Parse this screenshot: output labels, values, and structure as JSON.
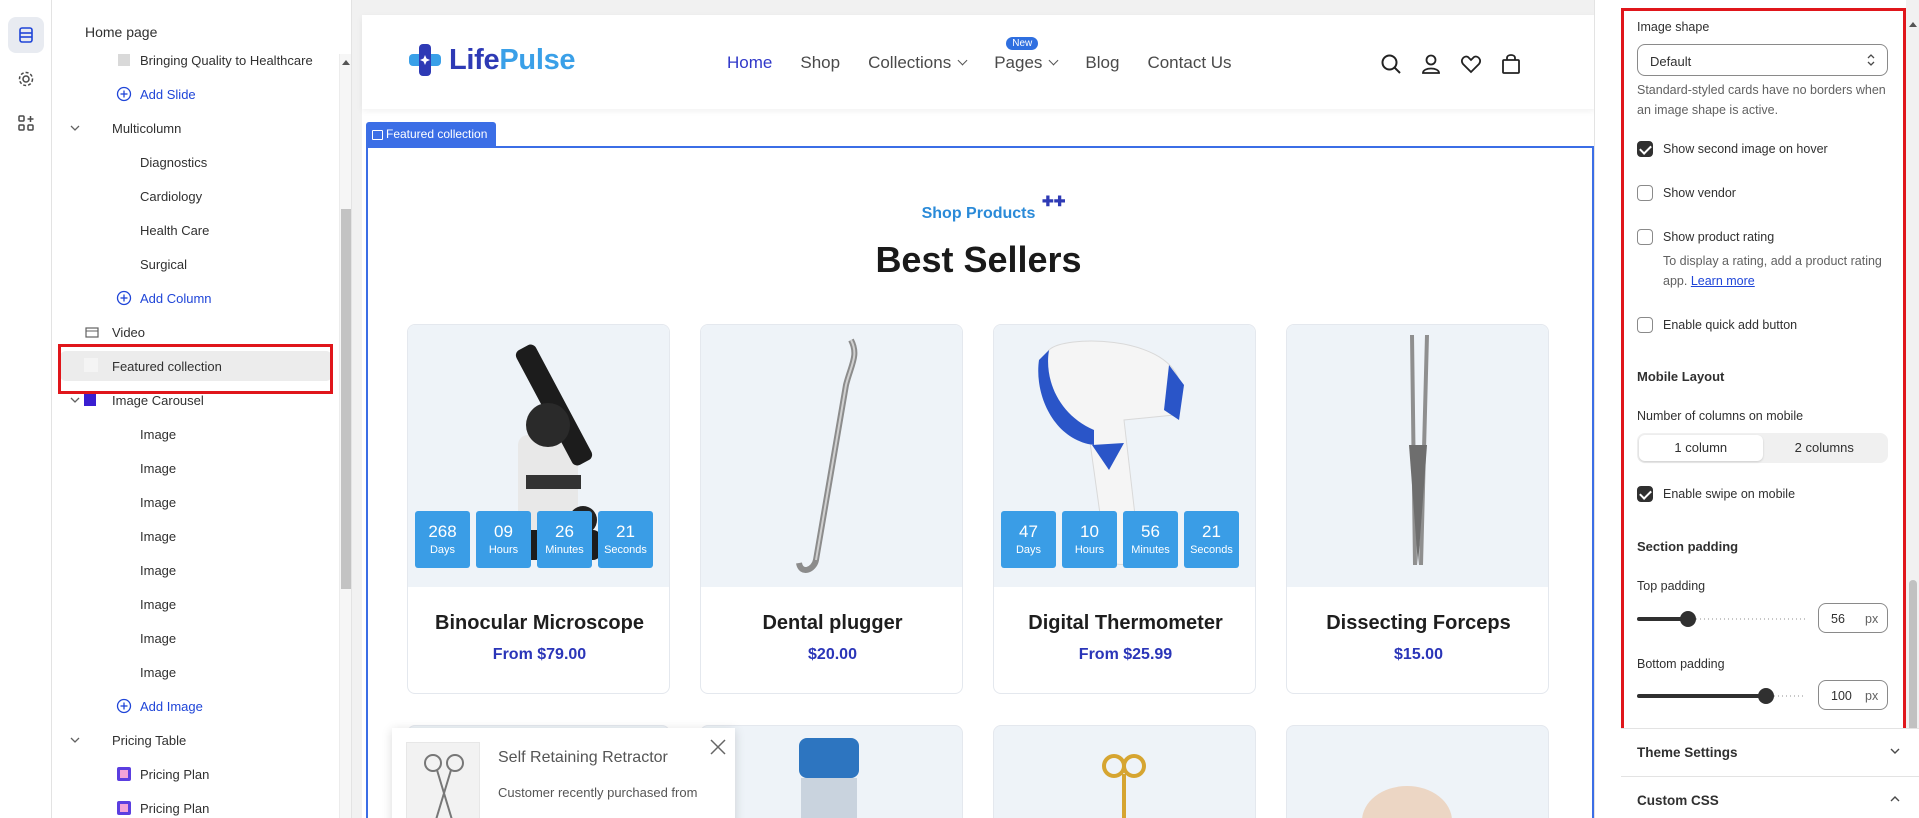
{
  "tree": {
    "header": "Home page",
    "rows": [
      {
        "label": "Bringing Quality to Healthcare",
        "kind": "item"
      },
      {
        "label": "Add Slide",
        "kind": "add"
      },
      {
        "label": "Multicolumn",
        "kind": "section"
      },
      {
        "label": "Diagnostics",
        "kind": "child"
      },
      {
        "label": "Cardiology",
        "kind": "child"
      },
      {
        "label": "Health Care",
        "kind": "child"
      },
      {
        "label": "Surgical",
        "kind": "child"
      },
      {
        "label": "Add Column",
        "kind": "add"
      },
      {
        "label": "Video",
        "kind": "section"
      },
      {
        "label": "Featured collection",
        "kind": "section"
      },
      {
        "label": "Image Carousel",
        "kind": "section"
      },
      {
        "label": "Image",
        "kind": "child"
      },
      {
        "label": "Image",
        "kind": "child"
      },
      {
        "label": "Image",
        "kind": "child"
      },
      {
        "label": "Image",
        "kind": "child"
      },
      {
        "label": "Image",
        "kind": "child"
      },
      {
        "label": "Image",
        "kind": "child"
      },
      {
        "label": "Image",
        "kind": "child"
      },
      {
        "label": "Image",
        "kind": "child"
      },
      {
        "label": "Add Image",
        "kind": "add"
      },
      {
        "label": "Pricing Table",
        "kind": "section"
      },
      {
        "label": "Pricing Plan",
        "kind": "item"
      },
      {
        "label": "Pricing Plan",
        "kind": "item"
      }
    ]
  },
  "store": {
    "logo_a": "Life",
    "logo_b": "Pulse",
    "nav": [
      {
        "label": "Home",
        "active": true,
        "dropdown": false
      },
      {
        "label": "Shop",
        "active": false,
        "dropdown": false
      },
      {
        "label": "Collections",
        "active": false,
        "dropdown": true
      },
      {
        "label": "Pages",
        "active": false,
        "dropdown": true,
        "badge": "New"
      },
      {
        "label": "Blog",
        "active": false,
        "dropdown": false
      },
      {
        "label": "Contact Us",
        "active": false,
        "dropdown": false
      }
    ],
    "section_tag": "Featured collection",
    "subtitle": "Shop Products",
    "title": "Best Sellers",
    "products": [
      {
        "name": "Binocular Microscope",
        "price": "From $79.00",
        "timer": [
          "268",
          "09",
          "26",
          "21"
        ]
      },
      {
        "name": "Dental plugger",
        "price": "$20.00"
      },
      {
        "name": "Digital Thermometer",
        "price": "From $25.99",
        "timer": [
          "47",
          "10",
          "56",
          "21"
        ]
      },
      {
        "name": "Dissecting Forceps",
        "price": "$15.00"
      }
    ],
    "timer_units": [
      "Days",
      "Hours",
      "Minutes",
      "Seconds"
    ],
    "toast": {
      "title": "Self Retaining Retractor",
      "body": "Customer recently purchased from"
    }
  },
  "settings": {
    "image_shape_label": "Image shape",
    "image_shape_value": "Default",
    "image_shape_help": "Standard-styled cards have no borders when an image shape is active.",
    "show_second_image": "Show second image on hover",
    "show_vendor": "Show vendor",
    "show_rating": "Show product rating",
    "rating_help": "To display a rating, add a product rating app.",
    "learn_more": "Learn more",
    "quick_add": "Enable quick add button",
    "mobile_layout": "Mobile Layout",
    "columns_mobile": "Number of columns on mobile",
    "col_1": "1 column",
    "col_2": "2 columns",
    "swipe": "Enable swipe on mobile",
    "section_padding": "Section padding",
    "top_padding": "Top padding",
    "top_padding_value": "56",
    "top_padding_fraction": 0.56,
    "bottom_padding": "Bottom padding",
    "bottom_padding_value": "100",
    "bottom_padding_fraction": 1.0,
    "px": "px",
    "theme_settings": "Theme Settings",
    "custom_css": "Custom CSS",
    "checks": {
      "second_image": true,
      "vendor": false,
      "rating": false,
      "quick_add": false,
      "swipe": true
    }
  },
  "colors": {
    "accent": "#3038c9",
    "brand_light": "#3aa0e8",
    "timer": "#3a9de6",
    "highlight": "#e0161b"
  }
}
